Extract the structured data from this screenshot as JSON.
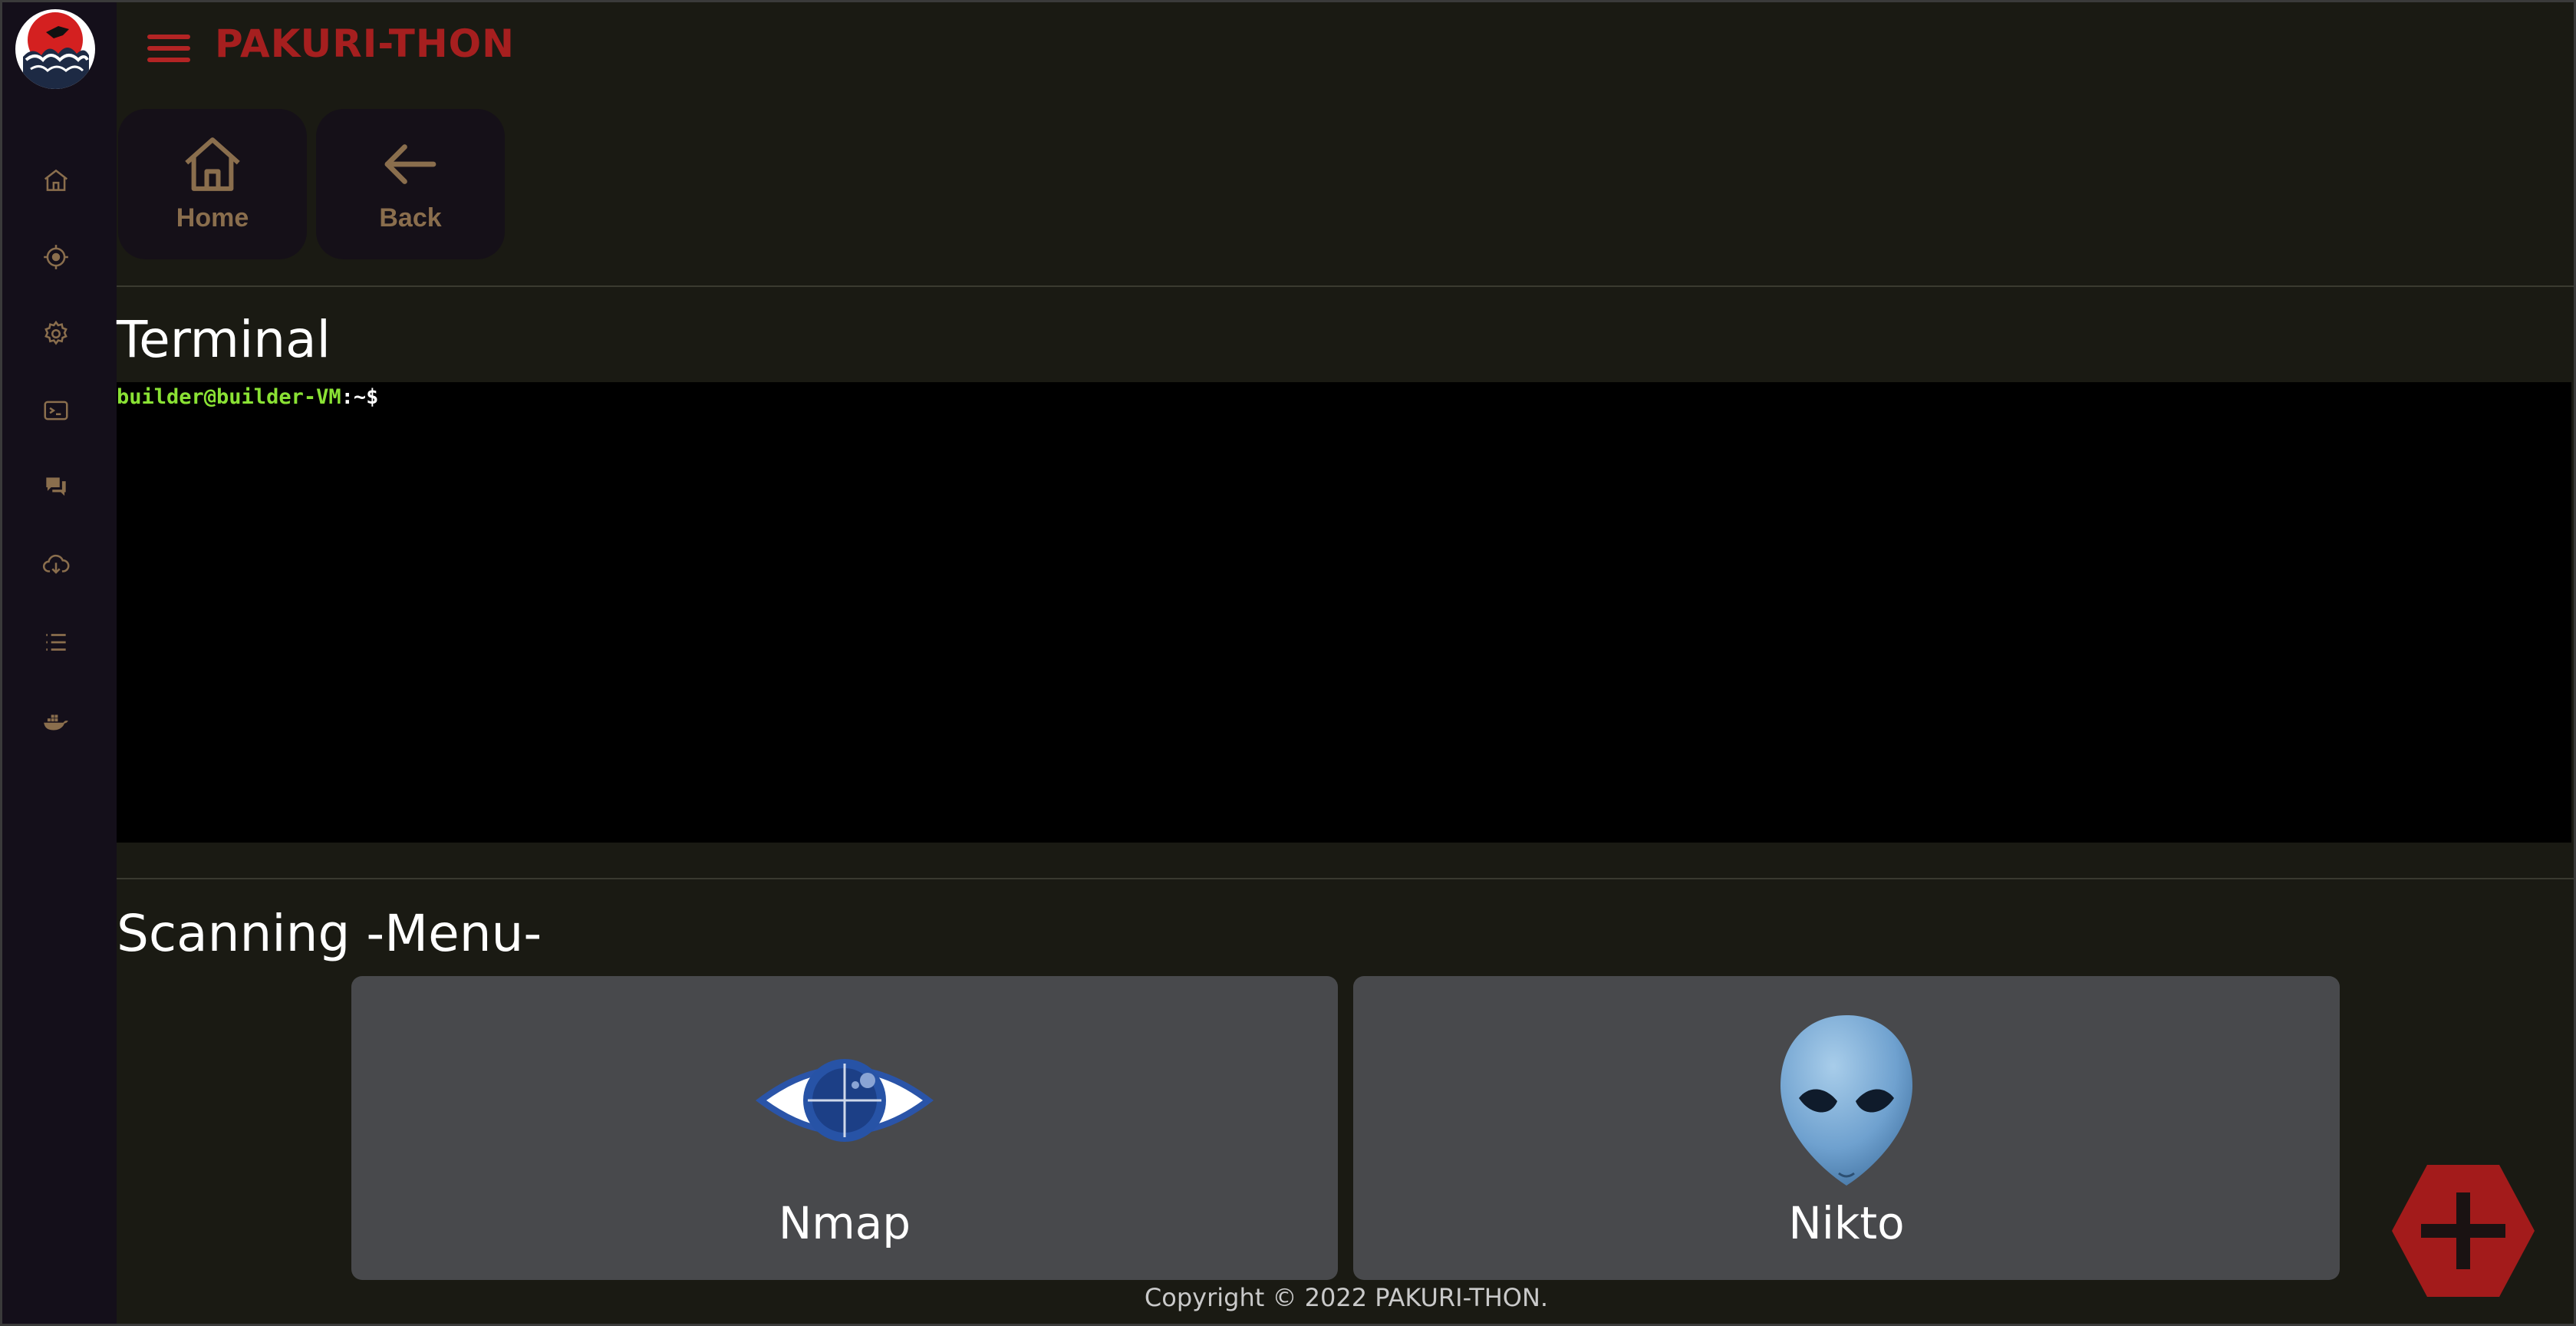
{
  "app": {
    "title": "PAKURI-THON"
  },
  "sidebar": {
    "items": [
      {
        "name": "home",
        "icon": "home-icon"
      },
      {
        "name": "scanning",
        "icon": "crosshair-icon"
      },
      {
        "name": "settings",
        "icon": "gear-icon"
      },
      {
        "name": "terminal",
        "icon": "terminal-icon"
      },
      {
        "name": "chat",
        "icon": "chat-icon"
      },
      {
        "name": "download",
        "icon": "cloud-download-icon"
      },
      {
        "name": "list",
        "icon": "list-icon"
      },
      {
        "name": "docker",
        "icon": "docker-icon"
      }
    ]
  },
  "nav": {
    "home_label": "Home",
    "back_label": "Back"
  },
  "terminal": {
    "title": "Terminal",
    "prompt_user": "builder@builder-VM",
    "prompt_sep": ":",
    "prompt_path": "~$"
  },
  "scanning": {
    "title": "Scanning -Menu-",
    "tools": [
      {
        "name": "Nmap",
        "icon": "nmap-eye-icon"
      },
      {
        "name": "Nikto",
        "icon": "nikto-alien-icon"
      }
    ]
  },
  "footer": {
    "copyright": "Copyright © 2022 PAKURI-THON."
  },
  "colors": {
    "accent": "#a61f1f",
    "nav_label": "#8a6e4d",
    "sidebar_icon": "#8a6e4d",
    "background": "#1a1a13",
    "card": "#48494c"
  }
}
